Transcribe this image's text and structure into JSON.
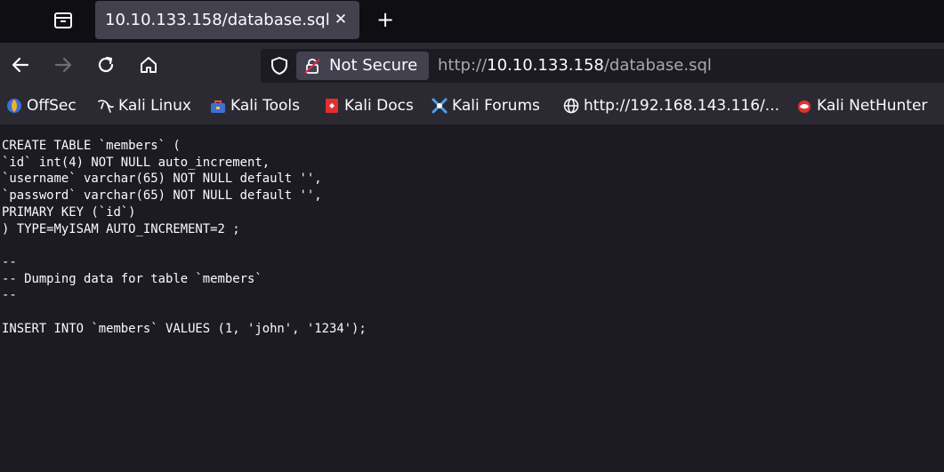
{
  "tab": {
    "title": "10.10.133.158/database.sql",
    "close": "✕",
    "new_tab": "+"
  },
  "urlbar": {
    "identity_text": "Not Secure",
    "url_prefix": "http://",
    "url_host": "10.10.133.158",
    "url_path": "/database.sql"
  },
  "bookmarks": [
    {
      "label": "OffSec",
      "icon": "offsec-icon"
    },
    {
      "label": "Kali Linux",
      "icon": "kali-dragon-icon"
    },
    {
      "label": "Kali Tools",
      "icon": "kali-tools-icon"
    },
    {
      "label": "Kali Docs",
      "icon": "kali-docs-icon"
    },
    {
      "label": "Kali Forums",
      "icon": "kali-forums-icon"
    },
    {
      "label": "http://192.168.143.116/...",
      "icon": "globe-icon"
    },
    {
      "label": "Kali NetHunter",
      "icon": "nethunter-icon"
    }
  ],
  "document": {
    "lines": [
      "CREATE TABLE `members` (",
      "`id` int(4) NOT NULL auto_increment,",
      "`username` varchar(65) NOT NULL default '',",
      "`password` varchar(65) NOT NULL default '',",
      "PRIMARY KEY (`id`)",
      ") TYPE=MyISAM AUTO_INCREMENT=2 ;",
      "",
      "--",
      "-- Dumping data for table `members`",
      "--",
      "",
      "INSERT INTO `members` VALUES (1, 'john', '1234');"
    ]
  },
  "colors": {
    "background": "#1c1b22",
    "toolbar": "#2b2a33",
    "tabbar": "#0f0e13",
    "tab_selected": "#42414d",
    "text": "#fbfbfe"
  }
}
